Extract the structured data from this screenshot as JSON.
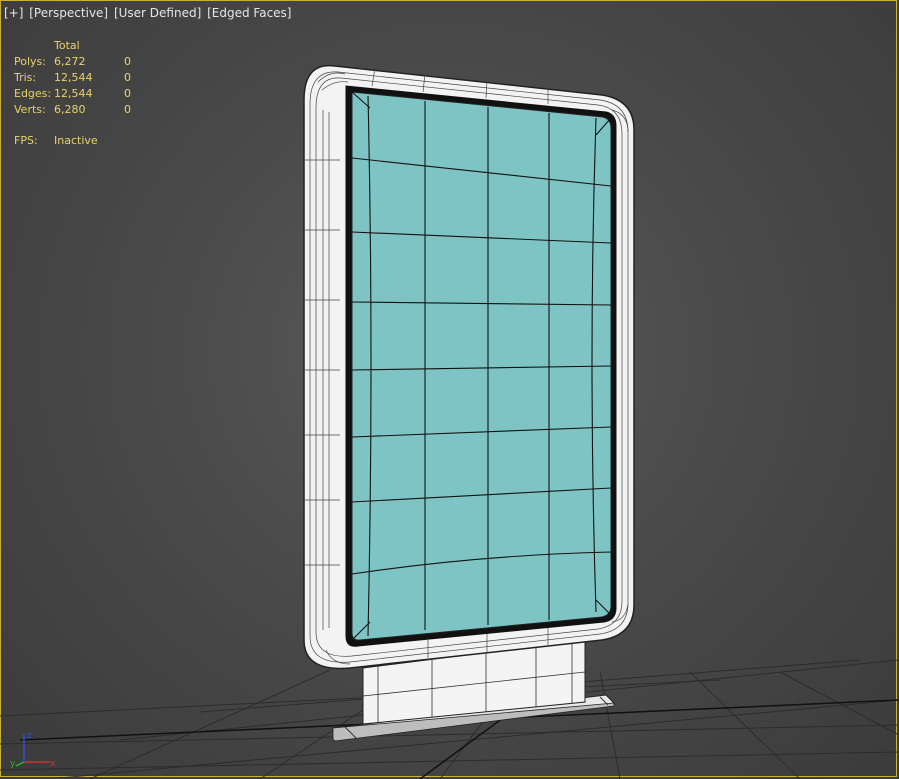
{
  "viewport": {
    "labels": [
      "[+]",
      "[Perspective]",
      "[User Defined]",
      "[Edged Faces]"
    ]
  },
  "stats": {
    "header": "Total",
    "rows": [
      {
        "label": "Polys:",
        "total": "6,272",
        "selected": "0"
      },
      {
        "label": "Tris:",
        "total": "12,544",
        "selected": "0"
      },
      {
        "label": "Edges:",
        "total": "12,544",
        "selected": "0"
      },
      {
        "label": "Verts:",
        "total": "6,280",
        "selected": "0"
      }
    ],
    "fps_label": "FPS:",
    "fps_value": "Inactive"
  },
  "axis_gizmo": {
    "x": "x",
    "y": "y",
    "z": "z"
  },
  "colors": {
    "border": "#c8b040",
    "stats_text": "#e8d36a",
    "screen_fill": "#7fc4c4",
    "frame_fill": "#f2f2f2"
  }
}
